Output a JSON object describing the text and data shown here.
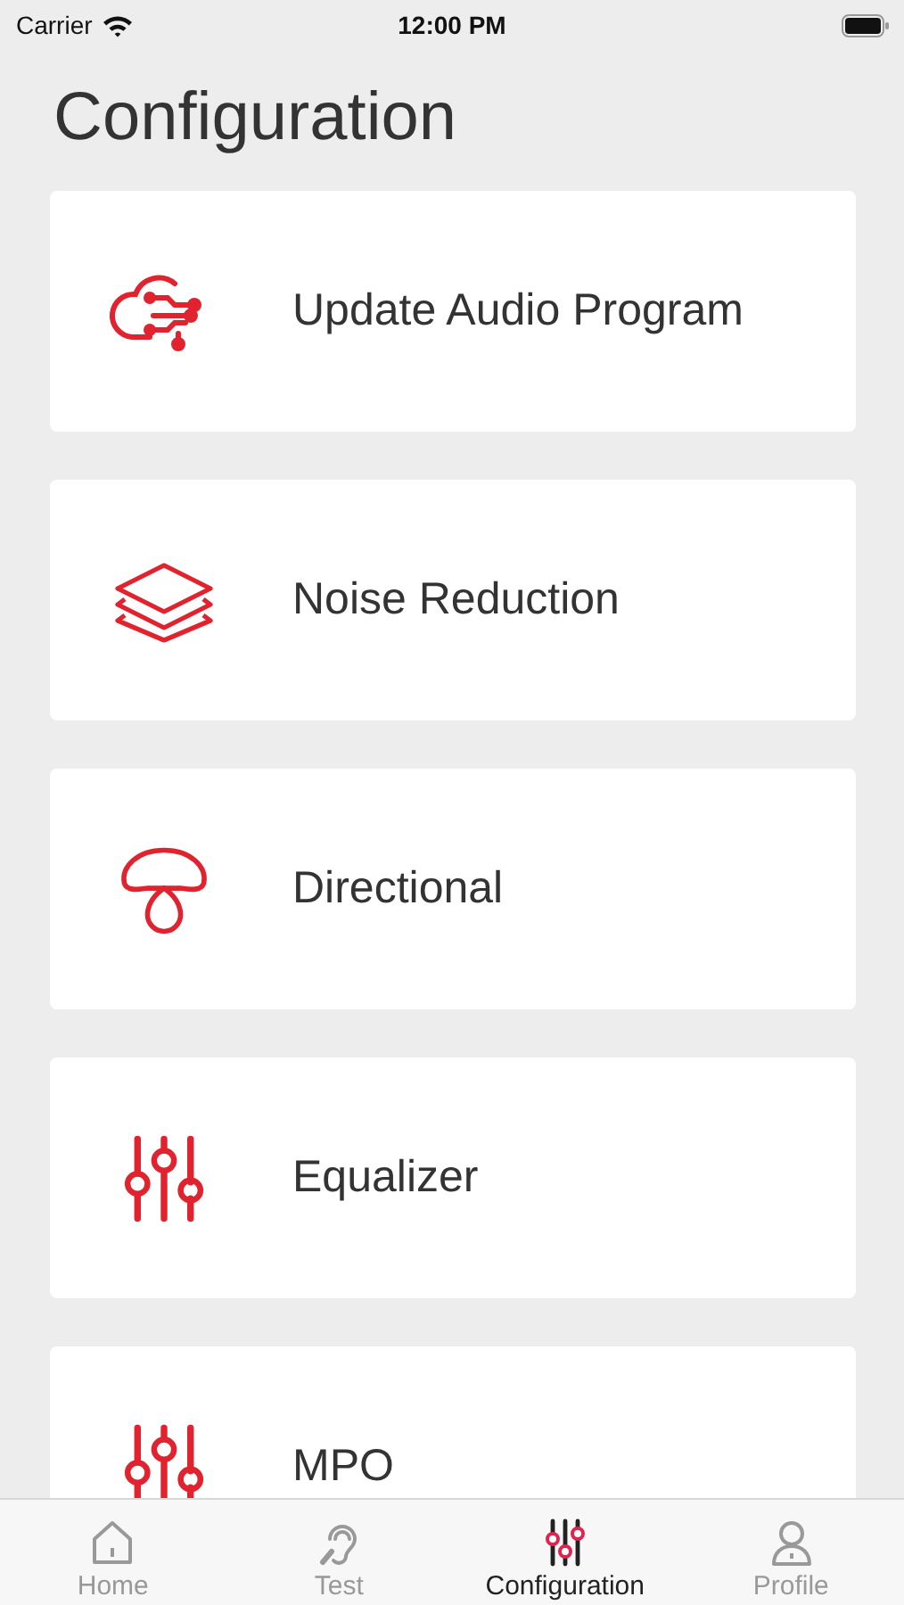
{
  "status_bar": {
    "carrier": "Carrier",
    "time": "12:00 PM"
  },
  "title": "Configuration",
  "items": [
    {
      "label": "Update Audio Program",
      "kind": "cloud"
    },
    {
      "label": "Noise Reduction",
      "kind": "layers"
    },
    {
      "label": "Directional",
      "kind": "mushroom"
    },
    {
      "label": "Equalizer",
      "kind": "sliders"
    },
    {
      "label": "MPO",
      "kind": "sliders"
    }
  ],
  "tabs": [
    {
      "label": "Home",
      "kind": "home",
      "selected": false
    },
    {
      "label": "Test",
      "kind": "ear",
      "selected": false
    },
    {
      "label": "Configuration",
      "kind": "sliders",
      "selected": true
    },
    {
      "label": "Profile",
      "kind": "person",
      "selected": false
    }
  ]
}
